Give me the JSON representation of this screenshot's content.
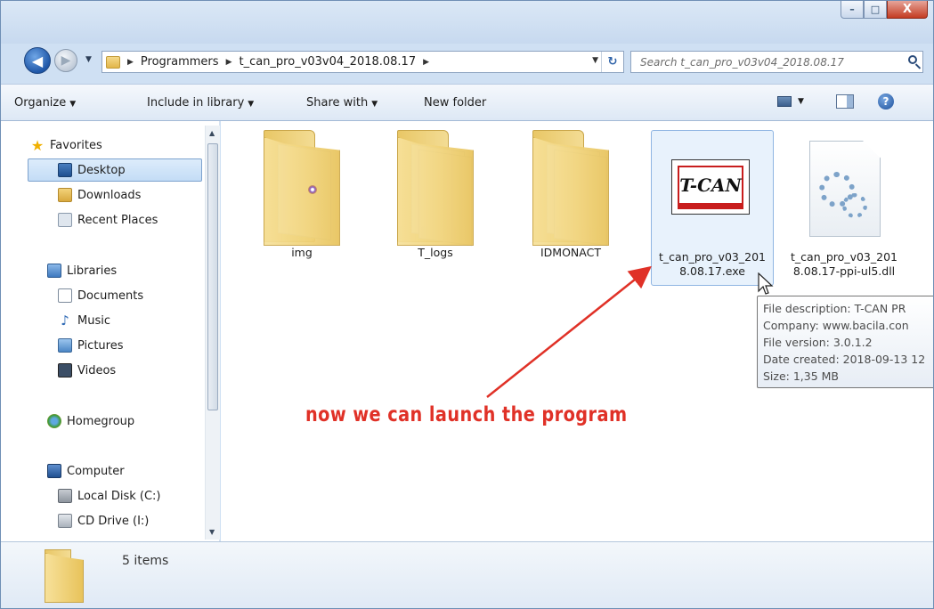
{
  "window": {
    "minimize_glyph": "–",
    "maximize_glyph": "□",
    "close_glyph": "X"
  },
  "nav": {
    "back_glyph": "◀",
    "forward_glyph": "▶",
    "recent_dropdown_glyph": "▼",
    "breadcrumbs": [
      "Programmers",
      "t_can_pro_v03v04_2018.08.17"
    ],
    "crumb_separator": "▶",
    "dropdown_glyph": "▼",
    "refresh_glyph": "↻"
  },
  "search": {
    "placeholder": "Search t_can_pro_v03v04_2018.08.17"
  },
  "toolbar": {
    "organize": "Organize",
    "include_in_library": "Include in library",
    "share_with": "Share with",
    "new_folder": "New folder",
    "dropdown_glyph": "▼",
    "help_glyph": "?"
  },
  "sidebar": {
    "favorites": "Favorites",
    "desktop": "Desktop",
    "downloads": "Downloads",
    "recent_places": "Recent Places",
    "libraries": "Libraries",
    "documents": "Documents",
    "music": "Music",
    "pictures": "Pictures",
    "videos": "Videos",
    "homegroup": "Homegroup",
    "computer": "Computer",
    "local_disk": "Local Disk (C:)",
    "cd_drive": "CD Drive (I:)",
    "scroll_up_glyph": "▲",
    "scroll_down_glyph": "▼"
  },
  "files": {
    "img": "img",
    "t_logs": "T_logs",
    "idmonact": "IDMONACT",
    "exe": "t_can_pro_v03_2018.08.17.exe",
    "dll": "t_can_pro_v03_2018.08.17-ppi-ul5.dll",
    "exe_logo_text": "T-CAN"
  },
  "tooltip": {
    "description": "File description: T-CAN PR",
    "company": "Company: www.bacila.con",
    "version": "File version: 3.0.1.2",
    "date_created": "Date created: 2018-09-13 12",
    "size": "Size: 1,35 MB"
  },
  "annotation": {
    "text": "now we can launch the program",
    "color": "#e03127"
  },
  "status": {
    "item_count": "5 items"
  }
}
